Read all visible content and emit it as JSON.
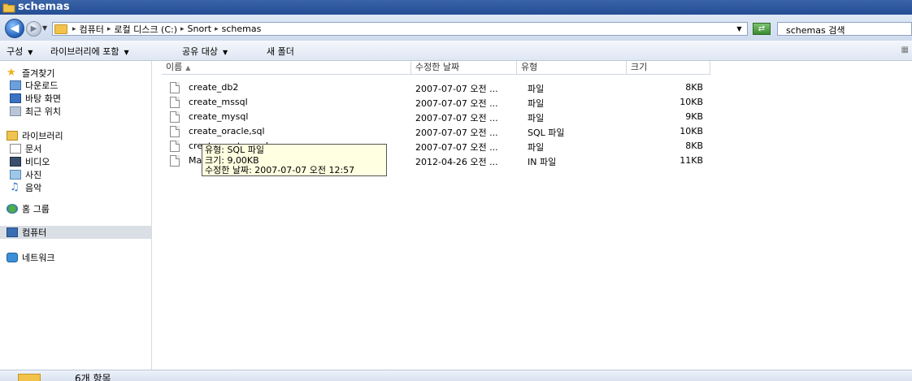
{
  "window": {
    "title": "schemas"
  },
  "address": {
    "crumbs": [
      "컴퓨터",
      "로컬 디스크 (C:)",
      "Snort",
      "schemas"
    ],
    "search_placeholder": "schemas 검색"
  },
  "toolbar": {
    "organize": "구성",
    "include_library": "라이브러리에 포함",
    "share": "공유 대상",
    "new_folder": "새 폴더"
  },
  "sidebar": {
    "favorites": "즐겨찾기",
    "downloads": "다운로드",
    "desktop": "바탕 화면",
    "recent": "최근 위치",
    "libraries": "라이브러리",
    "documents": "문서",
    "videos": "비디오",
    "pictures": "사진",
    "music": "음악",
    "homegroup": "홈 그룹",
    "computer": "컴퓨터",
    "network": "네트워크"
  },
  "columns": {
    "name": "이름",
    "modified": "수정한 날짜",
    "type": "유형",
    "size": "크기"
  },
  "files": [
    {
      "name": "create_db2",
      "modified": "2007-07-07 오전 ...",
      "type": "파일",
      "size": "8KB"
    },
    {
      "name": "create_mssql",
      "modified": "2007-07-07 오전 ...",
      "type": "파일",
      "size": "10KB"
    },
    {
      "name": "create_mysql",
      "modified": "2007-07-07 오전 ...",
      "type": "파일",
      "size": "9KB"
    },
    {
      "name": "create_oracle,sql",
      "modified": "2007-07-07 오전 ...",
      "type": "SQL 파일",
      "size": "10KB"
    },
    {
      "name": "create_postgresql",
      "modified": "2007-07-07 오전 ...",
      "type": "파일",
      "size": "8KB"
    },
    {
      "name": "Makefile.in",
      "modified": "2012-04-26 오전 ...",
      "type": "IN 파일",
      "size": "11KB"
    }
  ],
  "tooltip": {
    "type": "유형: SQL 파일",
    "size": "크기: 9,00KB",
    "modified": "수정한 날짜: 2007-07-07 오전 12:57"
  },
  "status": {
    "items": "6개 항목"
  }
}
